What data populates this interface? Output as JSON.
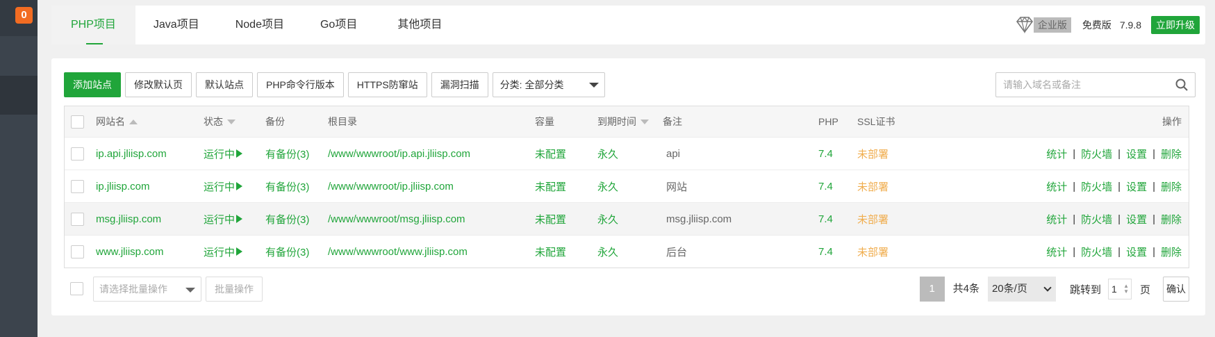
{
  "sidebar": {
    "badge": "0"
  },
  "tabs": [
    {
      "label": "PHP项目",
      "active": true
    },
    {
      "label": "Java项目",
      "active": false
    },
    {
      "label": "Node项目",
      "active": false
    },
    {
      "label": "Go项目",
      "active": false
    },
    {
      "label": "其他项目",
      "active": false
    }
  ],
  "header": {
    "enterprise_label": "企业版",
    "free_label": "免费版",
    "version": "7.9.8",
    "upgrade_label": "立即升级"
  },
  "toolbar": {
    "add_site": "添加站点",
    "modify_default": "修改默认页",
    "default_site": "默认站点",
    "php_cli": "PHP命令行版本",
    "https_guard": "HTTPS防窜站",
    "vuln_scan": "漏洞扫描",
    "category_select": "分类: 全部分类"
  },
  "search": {
    "placeholder": "请输入域名或备注"
  },
  "table": {
    "headers": {
      "name": "网站名",
      "status": "状态",
      "backup": "备份",
      "root": "根目录",
      "capacity": "容量",
      "expire": "到期时间",
      "remark": "备注",
      "php": "PHP",
      "ssl": "SSL证书",
      "ops": "操作"
    },
    "rows": [
      {
        "name": "ip.api.jliisp.com",
        "status": "运行中",
        "backup": "有备份(3)",
        "root": "/www/wwwroot/ip.api.jliisp.com",
        "capacity": "未配置",
        "expire": "永久",
        "remark": "api",
        "php": "7.4",
        "ssl": "未部署"
      },
      {
        "name": "ip.jliisp.com",
        "status": "运行中",
        "backup": "有备份(3)",
        "root": "/www/wwwroot/ip.jliisp.com",
        "capacity": "未配置",
        "expire": "永久",
        "remark": "网站",
        "php": "7.4",
        "ssl": "未部署"
      },
      {
        "name": "msg.jliisp.com",
        "status": "运行中",
        "backup": "有备份(3)",
        "root": "/www/wwwroot/msg.jliisp.com",
        "capacity": "未配置",
        "expire": "永久",
        "remark": "msg.jliisp.com",
        "php": "7.4",
        "ssl": "未部署"
      },
      {
        "name": "www.jliisp.com",
        "status": "运行中",
        "backup": "有备份(3)",
        "root": "/www/wwwroot/www.jliisp.com",
        "capacity": "未配置",
        "expire": "永久",
        "remark": "后台",
        "php": "7.4",
        "ssl": "未部署"
      }
    ],
    "ops": {
      "stats": "统计",
      "firewall": "防火墙",
      "settings": "设置",
      "delete": "删除",
      "separator": "|"
    }
  },
  "footer": {
    "batch_placeholder": "请选择批量操作",
    "batch_button": "批量操作",
    "page": "1",
    "total": "共4条",
    "page_size": "20条/页",
    "jump_to": "跳转到",
    "jump_value": "1",
    "page_unit": "页",
    "confirm": "确认"
  },
  "colors": {
    "accent": "#20a53a",
    "warning": "#f0ad4e",
    "badge": "#f26c22"
  }
}
